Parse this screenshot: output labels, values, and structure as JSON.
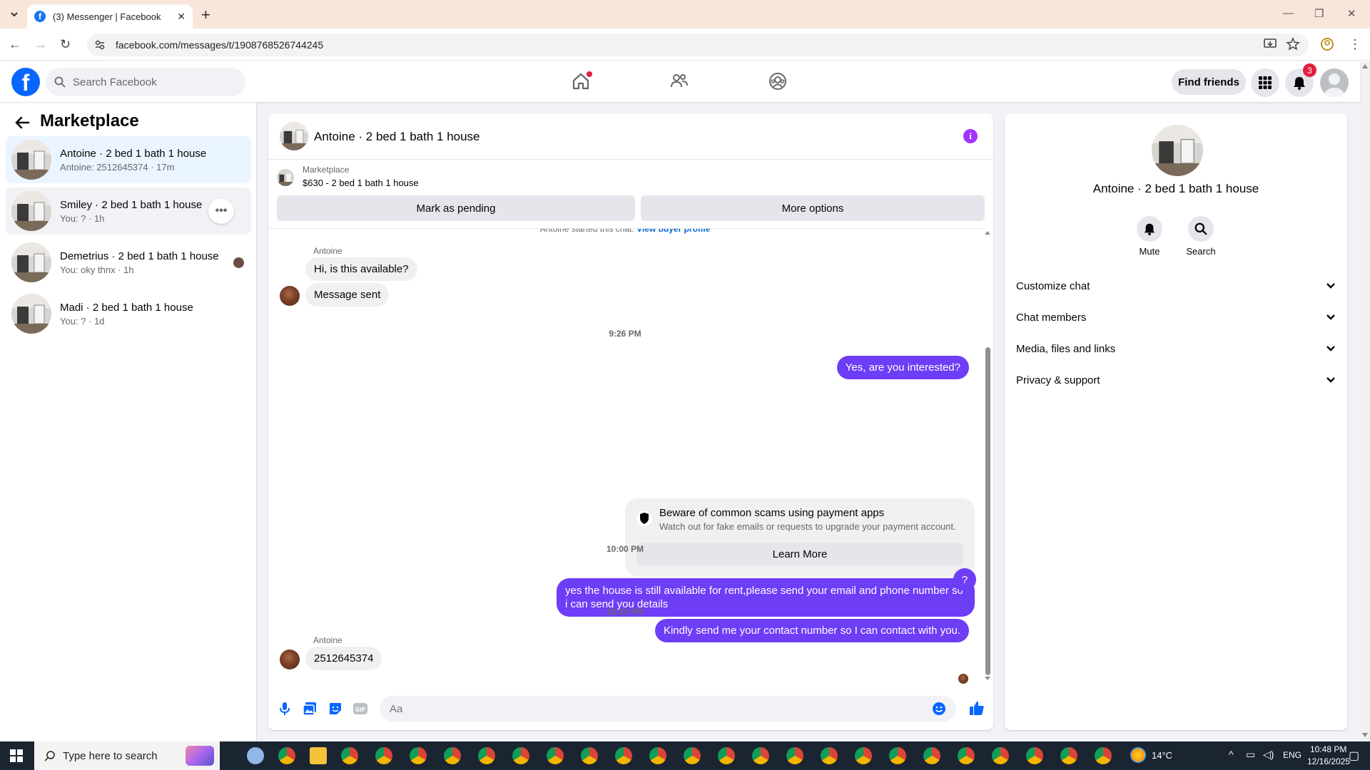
{
  "browser": {
    "tab_title": "(3) Messenger | Facebook",
    "url": "facebook.com/messages/t/1908768526744245"
  },
  "header": {
    "search_placeholder": "Search Facebook",
    "find_friends": "Find friends",
    "notification_count": "3"
  },
  "sidebar": {
    "title": "Marketplace",
    "conversations": [
      {
        "name": "Antoine · 2 bed 1 bath 1 house",
        "sub": "Antoine: 2512645374 · 17m"
      },
      {
        "name": "Smiley · 2 bed 1 bath 1 house",
        "sub": "You: ? · 1h"
      },
      {
        "name": "Demetrius · 2 bed 1 bath 1 house",
        "sub": "You: oky thnx · 1h"
      },
      {
        "name": "Madi · 2 bed 1 bath 1 house",
        "sub": "You: ? · 1d"
      }
    ]
  },
  "chat": {
    "title": "Antoine · 2 bed 1 bath 1 house",
    "listing_label": "Marketplace",
    "listing_price": "$630 - 2 bed 1 bath 1 house",
    "mark_pending": "Mark as pending",
    "more_options": "More options",
    "started_text": "Antoine started this chat.",
    "view_buyer": "View buyer profile",
    "sender1": "Antoine",
    "msg1": "Hi, is this available?",
    "msg2": "Message sent",
    "time1": "9:26 PM",
    "out1": "Yes, are you interested?",
    "scam_title": "Beware of common scams using payment apps",
    "scam_desc": "Watch out for fake emails or requests to upgrade your payment account.",
    "learn_more": "Learn More",
    "out2": "yes the house is still available for rent,please send your email and phone number so i can send you details",
    "out3": "Kindly send me your contact number so I can contact with you.",
    "time2": "10:00 PM",
    "out4": "?",
    "time3": "10:30 PM",
    "sender2": "Antoine",
    "msg3": "2512645374",
    "input_placeholder": "Aa"
  },
  "info": {
    "title": "Antoine · 2 bed 1 bath 1 house",
    "mute": "Mute",
    "search": "Search",
    "rows": [
      "Customize chat",
      "Chat members",
      "Media, files and links",
      "Privacy & support"
    ]
  },
  "taskbar": {
    "search_placeholder": "Type here to search",
    "temp": "14°C",
    "lang": "ENG",
    "time": "10:48 PM",
    "date": "12/16/2025"
  },
  "colors": {
    "accent": "#6e3df6",
    "facebook_blue": "#0866ff",
    "info_purple": "#a033ff"
  }
}
